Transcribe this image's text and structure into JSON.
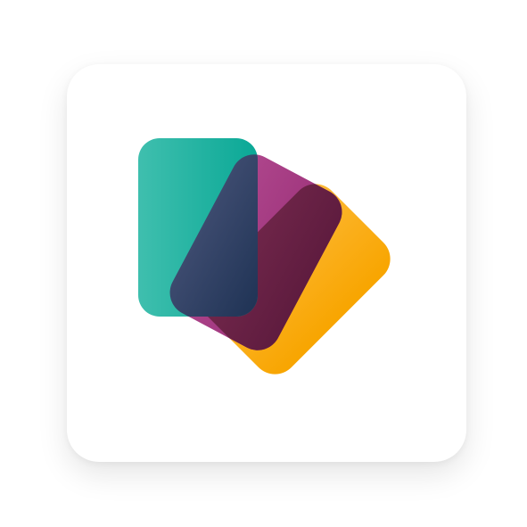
{
  "icon": {
    "name": "stacked-cards-logo-icon",
    "colors": {
      "tile_background": "#ffffff",
      "teal_card_light": "#3fbfae",
      "teal_card_dark": "#0aa896",
      "magenta_card_light": "#b0488e",
      "magenta_card_dark": "#9a2f77",
      "amber_card_light": "#fdba3a",
      "amber_card_dark": "#f8a500",
      "overlap_navy_light": "#3c4a6e",
      "overlap_navy_dark": "#152b4c",
      "overlap_plum_light": "#7a2c50",
      "overlap_plum_dark": "#5f1c3f"
    }
  }
}
